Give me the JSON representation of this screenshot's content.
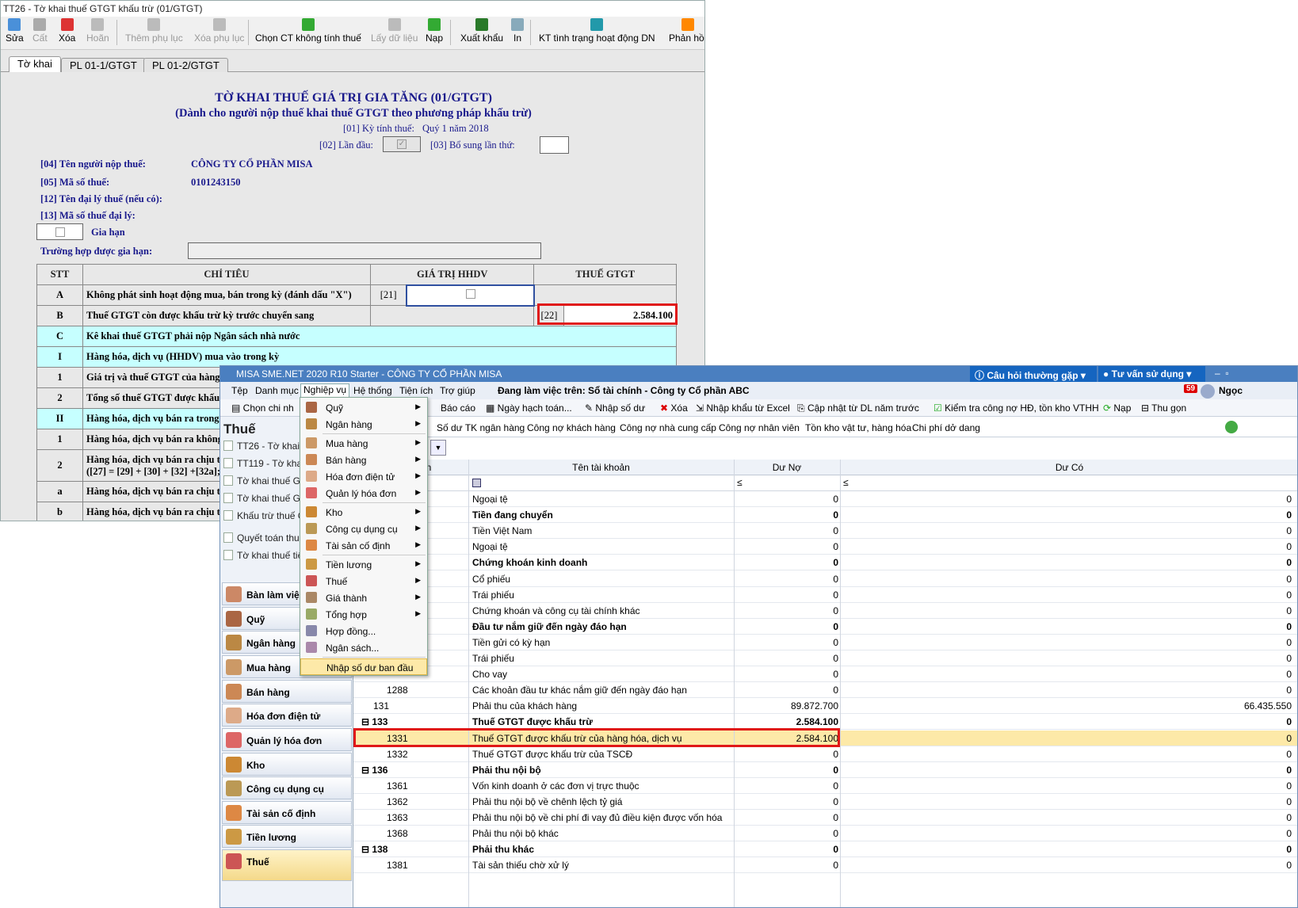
{
  "htkk": {
    "title": "TT26 - Tờ khai thuế GTGT khấu trừ (01/GTGT)",
    "toolbar": [
      "Sửa",
      "Cất",
      "Xóa",
      "Hoãn",
      "Thêm phụ lục",
      "Xóa phụ lục",
      "Chọn CT không tính thuế",
      "Lấy dữ liệu",
      "Nạp",
      "Xuất khẩu",
      "In",
      "KT tình trạng hoạt động DN",
      "Phản hồi"
    ],
    "tabs": [
      "Tờ khai",
      "PL 01-1/GTGT",
      "PL 01-2/GTGT"
    ],
    "form_title": "TỜ KHAI THUẾ GIÁ TRỊ GIA TĂNG (01/GTGT)",
    "form_subtitle": "(Dành cho người nộp thuế khai thuế GTGT theo phương pháp khấu trừ)",
    "period_label": "[01] Kỳ tính thuế:",
    "period_value": "Quý 1 năm 2018",
    "first_label": "[02] Lần đầu:",
    "supp_label": "[03] Bổ sung lần thứ:",
    "f04_label": "[04] Tên người nộp thuế:",
    "f04_value": "CÔNG TY CỔ PHẦN MISA",
    "f05_label": "[05] Mã số thuế:",
    "f05_value": "0101243150",
    "f12_label": "[12] Tên đại lý thuế (nếu có):",
    "f13_label": "[13] Mã số thuế đại lý:",
    "extend_label": "Gia hạn",
    "extend_case_label": "Trường hợp được gia hạn:",
    "table_headers": [
      "STT",
      "CHỈ TIÊU",
      "GIÁ TRỊ HHDV",
      "THUẾ GTGT"
    ],
    "rows": [
      {
        "stt": "A",
        "ct": "Không phát sinh hoạt động mua, bán trong kỳ (đánh dấu \"X\")",
        "code": "[21]"
      },
      {
        "stt": "B",
        "ct": "Thuế GTGT còn được khấu trừ kỳ trước chuyển sang",
        "code": "[22]",
        "value": "2.584.100"
      },
      {
        "stt": "C",
        "ct": "Kê khai thuế GTGT phải nộp Ngân sách nhà nước"
      },
      {
        "stt": "I",
        "ct": "Hàng hóa, dịch vụ (HHDV) mua vào trong kỳ"
      },
      {
        "stt": "1",
        "ct": "Giá trị và thuế GTGT của hàng"
      },
      {
        "stt": "2",
        "ct": "Tổng số thuế GTGT  được khấu"
      },
      {
        "stt": "II",
        "ct": "Hàng hóa, dịch vụ bán ra trong"
      },
      {
        "stt": "1",
        "ct": "Hàng hóa, dịch vụ bán ra không"
      },
      {
        "stt": "2",
        "ct": "Hàng hóa, dịch vụ bán ra chịu t",
        "ct2": "([27] = [29] + [30] + [32] +[32a];"
      },
      {
        "stt": "a",
        "ct": "Hàng hóa, dịch vụ bán ra chịu th"
      },
      {
        "stt": "b",
        "ct": "Hàng hóa, dịch vụ bán ra chịu th"
      }
    ]
  },
  "misa": {
    "title": "MISA SME.NET 2020 R10 Starter - CÔNG TY CỔ PHẦN MISA",
    "faq": "Câu hỏi thường gặp",
    "consult": "Tư vấn sử dụng",
    "menu": [
      "Tệp",
      "Danh mục",
      "Nghiệp vụ",
      "Hệ thống",
      "Tiện ích",
      "Trợ giúp"
    ],
    "working_on": "Đang làm việc trên: Sổ tài chính - Công ty Cổ phần ABC",
    "badge": "59",
    "user": "Ngọc",
    "toolbar": [
      "Chọn chi nh",
      "Báo cáo",
      "Ngày hạch toán...",
      "Nhập số dư",
      "Xóa",
      "Nhập khẩu từ Excel",
      "Cập nhật từ DL năm trước",
      "Kiểm tra công nợ HĐ, tồn kho VTHH",
      "Nạp",
      "Thu gọn"
    ],
    "left_title": "Thuế",
    "left_items": [
      "TT26 - Tờ khai",
      "TT119 - Tờ kha",
      "Tờ khai thuế GT",
      "Tờ khai thuế GT",
      "Khấu trừ thuế G",
      "Quyết toán thuế",
      "Tờ khai thuế tiê"
    ],
    "nav": [
      "Bàn làm việc",
      "Quỹ",
      "Ngân hàng",
      "Mua hàng",
      "Bán hàng",
      "Hóa đơn điện tử",
      "Quản lý hóa đơn",
      "Kho",
      "Công cụ dụng cụ",
      "Tài sản cố định",
      "Tiền lương",
      "Thuế"
    ],
    "subtabs": [
      "Số dư TK ngân hàng",
      "Công nợ khách hàng",
      "Công nợ nhà cung cấp",
      "Công nợ nhân viên",
      "Tồn kho vật tư, hàng hóa",
      "Chi phí dở dang"
    ],
    "grid_headers": [
      "an",
      "Tên tài khoản",
      "Dư Nợ",
      "Dư Có"
    ],
    "filter_le": "≤",
    "rows": [
      {
        "code": "",
        "name": "Ngoại tệ",
        "no": "0",
        "co": "0"
      },
      {
        "code": "",
        "name": "Tiền đang chuyển",
        "no": "0",
        "co": "0",
        "bold": true
      },
      {
        "code": "",
        "name": "Tiền Việt Nam",
        "no": "0",
        "co": "0"
      },
      {
        "code": "",
        "name": "Ngoại tệ",
        "no": "0",
        "co": "0"
      },
      {
        "code": "",
        "name": "Chứng khoán kinh doanh",
        "no": "0",
        "co": "0",
        "bold": true
      },
      {
        "code": "",
        "name": "Cổ phiếu",
        "no": "0",
        "co": "0"
      },
      {
        "code": "",
        "name": "Trái phiếu",
        "no": "0",
        "co": "0"
      },
      {
        "code": "",
        "name": "Chứng khoán và công cụ tài chính khác",
        "no": "0",
        "co": "0"
      },
      {
        "code": "",
        "name": "Đầu tư nắm giữ đến ngày đáo hạn",
        "no": "0",
        "co": "0",
        "bold": true
      },
      {
        "code": "",
        "name": "Tiền gửi có kỳ hạn",
        "no": "0",
        "co": "0"
      },
      {
        "code": "",
        "name": "Trái phiếu",
        "no": "0",
        "co": "0"
      },
      {
        "code": "",
        "name": "Cho vay",
        "no": "0",
        "co": "0"
      },
      {
        "code": "1288",
        "name": "Các khoản đầu tư khác nắm giữ đến ngày đáo hạn",
        "no": "0",
        "co": "0"
      },
      {
        "code": "131",
        "name": "Phải thu của khách hàng",
        "no": "89.872.700",
        "co": "66.435.550"
      },
      {
        "code": "⊟ 133",
        "name": "Thuế GTGT được khấu trừ",
        "no": "2.584.100",
        "co": "0",
        "bold": true
      },
      {
        "code": "1331",
        "name": "Thuế GTGT được khấu trừ của hàng hóa, dịch vụ",
        "no": "2.584.100",
        "co": "0",
        "sel": true
      },
      {
        "code": "1332",
        "name": "Thuế GTGT được khấu trừ của TSCĐ",
        "no": "0",
        "co": "0"
      },
      {
        "code": "⊟ 136",
        "name": "Phải thu nội bộ",
        "no": "0",
        "co": "0",
        "bold": true
      },
      {
        "code": "1361",
        "name": "Vốn kinh doanh ở các đơn vị trực thuộc",
        "no": "0",
        "co": "0"
      },
      {
        "code": "1362",
        "name": "Phải thu nội bộ về chênh lệch tỷ giá",
        "no": "0",
        "co": "0"
      },
      {
        "code": "1363",
        "name": "Phải thu nội bộ về chi phí đi vay đủ điều kiện được vốn hóa",
        "no": "0",
        "co": "0"
      },
      {
        "code": "1368",
        "name": "Phải thu nội bộ khác",
        "no": "0",
        "co": "0"
      },
      {
        "code": "⊟ 138",
        "name": "Phải thu khác",
        "no": "0",
        "co": "0",
        "bold": true
      },
      {
        "code": "1381",
        "name": "Tài sản thiếu chờ xử lý",
        "no": "0",
        "co": "0"
      }
    ],
    "dropdown": [
      "Quỹ",
      "Ngân hàng",
      "Mua hàng",
      "Bán hàng",
      "Hóa đơn điện tử",
      "Quản lý hóa đơn",
      "Kho",
      "Công cụ dụng cụ",
      "Tài sản cố định",
      "Tiền lương",
      "Thuế",
      "Giá thành",
      "Tổng hợp",
      "Hợp đồng...",
      "Ngân sách...",
      "Nhập số dư ban đầu"
    ]
  },
  "colors": {
    "red": "#e01818",
    "cyan": "#c6ffff",
    "navy": "#1a1a8c",
    "highlight": "#fde9a8"
  }
}
